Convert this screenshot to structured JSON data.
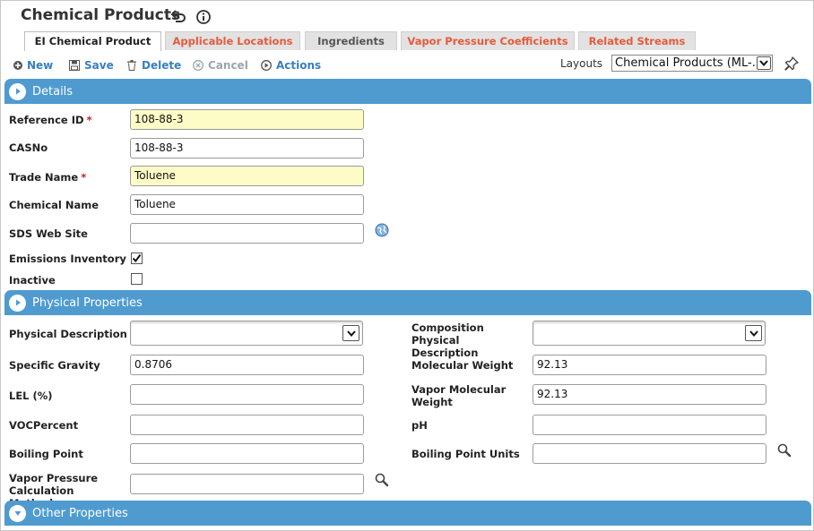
{
  "page": {
    "title": "Chemical Products",
    "back_icon": "return-arrow-icon",
    "info_icon": "info-circle-icon"
  },
  "tabs": [
    {
      "label": "EI Chemical Product",
      "active": true
    },
    {
      "label": "Applicable Locations",
      "active": false
    },
    {
      "label": "Ingredients",
      "active": false
    },
    {
      "label": "Vapor Pressure Coefficients",
      "active": false
    },
    {
      "label": "Related Streams",
      "active": false
    }
  ],
  "toolbar": {
    "new_label": "New",
    "save_label": "Save",
    "delete_label": "Delete",
    "cancel_label": "Cancel",
    "actions_label": "Actions",
    "layouts_label": "Layouts",
    "layouts_value": "Chemical Products (ML-..."
  },
  "sections": {
    "details": "Details",
    "physical": "Physical Properties",
    "other": "Other Properties"
  },
  "details": {
    "reference_id": {
      "label": "Reference ID",
      "value": "108-88-3"
    },
    "casno": {
      "label": "CASNo",
      "value": "108-88-3"
    },
    "trade_name": {
      "label": "Trade Name",
      "value": "Toluene"
    },
    "chemical_name": {
      "label": "Chemical Name",
      "value": "Toluene"
    },
    "sds_web_site": {
      "label": "SDS Web Site",
      "value": ""
    },
    "emissions_inventory": {
      "label": "Emissions Inventory",
      "checked": true
    },
    "inactive": {
      "label": "Inactive",
      "checked": false
    },
    "required_mark": "*"
  },
  "physical": {
    "physical_description": {
      "label": "Physical Description",
      "value": ""
    },
    "composition_physical_description": {
      "label": "Composition Physical Description",
      "value": ""
    },
    "specific_gravity": {
      "label": "Specific Gravity",
      "value": "0.8706"
    },
    "molecular_weight": {
      "label": "Molecular Weight",
      "value": "92.13"
    },
    "lel": {
      "label": "LEL (%)",
      "value": ""
    },
    "vapor_molecular_weight": {
      "label": "Vapor Molecular Weight",
      "value": "92.13"
    },
    "voc_percent": {
      "label": "VOCPercent",
      "value": ""
    },
    "ph": {
      "label": "pH",
      "value": ""
    },
    "boiling_point": {
      "label": "Boiling Point",
      "value": ""
    },
    "boiling_point_units": {
      "label": "Boiling Point Units",
      "value": ""
    },
    "vapor_pressure_method": {
      "label": "Vapor Pressure Calculation Method",
      "value": ""
    }
  },
  "colors": {
    "section_bar": "#4f9bd0",
    "tab_inactive_text": "#e55b3c",
    "required_field_bg": "#fdfcc6",
    "toolbar_text": "#3a7ebf"
  }
}
